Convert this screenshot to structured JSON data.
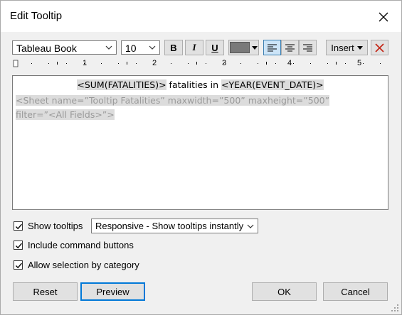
{
  "window": {
    "title": "Edit Tooltip"
  },
  "toolbar": {
    "font_family": "Tableau Book",
    "font_size": "10",
    "bold_label": "B",
    "italic_label": "I",
    "underline_label": "U",
    "insert_label": "Insert",
    "color_swatch": "#7a7a7a"
  },
  "ruler": {
    "labels": [
      "1",
      "2",
      "3",
      "4",
      "5"
    ]
  },
  "editor": {
    "line1": {
      "tag_sum": "<SUM(FATALITIES)>",
      "text_mid": " fatalities in ",
      "tag_year": "<YEAR(EVENT_DATE)>"
    },
    "line2": "<Sheet name=”Tooltip Fatalities” maxwidth=”500” maxheight=”500” filter=”<All Fields>”>"
  },
  "options": {
    "show_tooltips": {
      "label": "Show tooltips",
      "checked": true
    },
    "tooltip_mode": "Responsive - Show tooltips instantly",
    "include_command_buttons": {
      "label": "Include command buttons",
      "checked": true
    },
    "allow_selection": {
      "label": "Allow selection by category",
      "checked": true
    }
  },
  "buttons": {
    "reset": "Reset",
    "preview": "Preview",
    "ok": "OK",
    "cancel": "Cancel"
  },
  "colors": {
    "accent": "#0078d7",
    "active_toggle": "#cce4f7",
    "delete_red": "#c42b1c"
  }
}
